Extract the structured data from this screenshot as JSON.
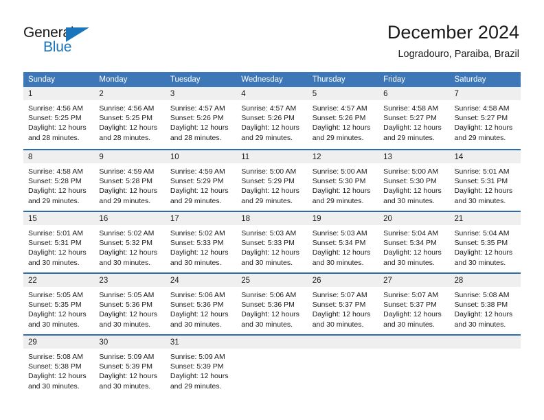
{
  "brand": {
    "name_part1": "General",
    "name_part2": "Blue",
    "accent_color": "#1b75bb"
  },
  "header": {
    "title": "December 2024",
    "subtitle": "Logradouro, Paraiba, Brazil"
  },
  "theme": {
    "header_blue": "#3d77b8",
    "separator_blue": "#2e6ba8",
    "daynum_bg": "#efefef"
  },
  "weekday_headers": [
    "Sunday",
    "Monday",
    "Tuesday",
    "Wednesday",
    "Thursday",
    "Friday",
    "Saturday"
  ],
  "weeks": [
    [
      {
        "day": "1",
        "sunrise": "Sunrise: 4:56 AM",
        "sunset": "Sunset: 5:25 PM",
        "daylight": "Daylight: 12 hours and 28 minutes."
      },
      {
        "day": "2",
        "sunrise": "Sunrise: 4:56 AM",
        "sunset": "Sunset: 5:25 PM",
        "daylight": "Daylight: 12 hours and 28 minutes."
      },
      {
        "day": "3",
        "sunrise": "Sunrise: 4:57 AM",
        "sunset": "Sunset: 5:26 PM",
        "daylight": "Daylight: 12 hours and 28 minutes."
      },
      {
        "day": "4",
        "sunrise": "Sunrise: 4:57 AM",
        "sunset": "Sunset: 5:26 PM",
        "daylight": "Daylight: 12 hours and 29 minutes."
      },
      {
        "day": "5",
        "sunrise": "Sunrise: 4:57 AM",
        "sunset": "Sunset: 5:26 PM",
        "daylight": "Daylight: 12 hours and 29 minutes."
      },
      {
        "day": "6",
        "sunrise": "Sunrise: 4:58 AM",
        "sunset": "Sunset: 5:27 PM",
        "daylight": "Daylight: 12 hours and 29 minutes."
      },
      {
        "day": "7",
        "sunrise": "Sunrise: 4:58 AM",
        "sunset": "Sunset: 5:27 PM",
        "daylight": "Daylight: 12 hours and 29 minutes."
      }
    ],
    [
      {
        "day": "8",
        "sunrise": "Sunrise: 4:58 AM",
        "sunset": "Sunset: 5:28 PM",
        "daylight": "Daylight: 12 hours and 29 minutes."
      },
      {
        "day": "9",
        "sunrise": "Sunrise: 4:59 AM",
        "sunset": "Sunset: 5:28 PM",
        "daylight": "Daylight: 12 hours and 29 minutes."
      },
      {
        "day": "10",
        "sunrise": "Sunrise: 4:59 AM",
        "sunset": "Sunset: 5:29 PM",
        "daylight": "Daylight: 12 hours and 29 minutes."
      },
      {
        "day": "11",
        "sunrise": "Sunrise: 5:00 AM",
        "sunset": "Sunset: 5:29 PM",
        "daylight": "Daylight: 12 hours and 29 minutes."
      },
      {
        "day": "12",
        "sunrise": "Sunrise: 5:00 AM",
        "sunset": "Sunset: 5:30 PM",
        "daylight": "Daylight: 12 hours and 29 minutes."
      },
      {
        "day": "13",
        "sunrise": "Sunrise: 5:00 AM",
        "sunset": "Sunset: 5:30 PM",
        "daylight": "Daylight: 12 hours and 30 minutes."
      },
      {
        "day": "14",
        "sunrise": "Sunrise: 5:01 AM",
        "sunset": "Sunset: 5:31 PM",
        "daylight": "Daylight: 12 hours and 30 minutes."
      }
    ],
    [
      {
        "day": "15",
        "sunrise": "Sunrise: 5:01 AM",
        "sunset": "Sunset: 5:31 PM",
        "daylight": "Daylight: 12 hours and 30 minutes."
      },
      {
        "day": "16",
        "sunrise": "Sunrise: 5:02 AM",
        "sunset": "Sunset: 5:32 PM",
        "daylight": "Daylight: 12 hours and 30 minutes."
      },
      {
        "day": "17",
        "sunrise": "Sunrise: 5:02 AM",
        "sunset": "Sunset: 5:33 PM",
        "daylight": "Daylight: 12 hours and 30 minutes."
      },
      {
        "day": "18",
        "sunrise": "Sunrise: 5:03 AM",
        "sunset": "Sunset: 5:33 PM",
        "daylight": "Daylight: 12 hours and 30 minutes."
      },
      {
        "day": "19",
        "sunrise": "Sunrise: 5:03 AM",
        "sunset": "Sunset: 5:34 PM",
        "daylight": "Daylight: 12 hours and 30 minutes."
      },
      {
        "day": "20",
        "sunrise": "Sunrise: 5:04 AM",
        "sunset": "Sunset: 5:34 PM",
        "daylight": "Daylight: 12 hours and 30 minutes."
      },
      {
        "day": "21",
        "sunrise": "Sunrise: 5:04 AM",
        "sunset": "Sunset: 5:35 PM",
        "daylight": "Daylight: 12 hours and 30 minutes."
      }
    ],
    [
      {
        "day": "22",
        "sunrise": "Sunrise: 5:05 AM",
        "sunset": "Sunset: 5:35 PM",
        "daylight": "Daylight: 12 hours and 30 minutes."
      },
      {
        "day": "23",
        "sunrise": "Sunrise: 5:05 AM",
        "sunset": "Sunset: 5:36 PM",
        "daylight": "Daylight: 12 hours and 30 minutes."
      },
      {
        "day": "24",
        "sunrise": "Sunrise: 5:06 AM",
        "sunset": "Sunset: 5:36 PM",
        "daylight": "Daylight: 12 hours and 30 minutes."
      },
      {
        "day": "25",
        "sunrise": "Sunrise: 5:06 AM",
        "sunset": "Sunset: 5:36 PM",
        "daylight": "Daylight: 12 hours and 30 minutes."
      },
      {
        "day": "26",
        "sunrise": "Sunrise: 5:07 AM",
        "sunset": "Sunset: 5:37 PM",
        "daylight": "Daylight: 12 hours and 30 minutes."
      },
      {
        "day": "27",
        "sunrise": "Sunrise: 5:07 AM",
        "sunset": "Sunset: 5:37 PM",
        "daylight": "Daylight: 12 hours and 30 minutes."
      },
      {
        "day": "28",
        "sunrise": "Sunrise: 5:08 AM",
        "sunset": "Sunset: 5:38 PM",
        "daylight": "Daylight: 12 hours and 30 minutes."
      }
    ],
    [
      {
        "day": "29",
        "sunrise": "Sunrise: 5:08 AM",
        "sunset": "Sunset: 5:38 PM",
        "daylight": "Daylight: 12 hours and 30 minutes."
      },
      {
        "day": "30",
        "sunrise": "Sunrise: 5:09 AM",
        "sunset": "Sunset: 5:39 PM",
        "daylight": "Daylight: 12 hours and 30 minutes."
      },
      {
        "day": "31",
        "sunrise": "Sunrise: 5:09 AM",
        "sunset": "Sunset: 5:39 PM",
        "daylight": "Daylight: 12 hours and 29 minutes."
      },
      {
        "day": "",
        "sunrise": "",
        "sunset": "",
        "daylight": ""
      },
      {
        "day": "",
        "sunrise": "",
        "sunset": "",
        "daylight": ""
      },
      {
        "day": "",
        "sunrise": "",
        "sunset": "",
        "daylight": ""
      },
      {
        "day": "",
        "sunrise": "",
        "sunset": "",
        "daylight": ""
      }
    ]
  ]
}
